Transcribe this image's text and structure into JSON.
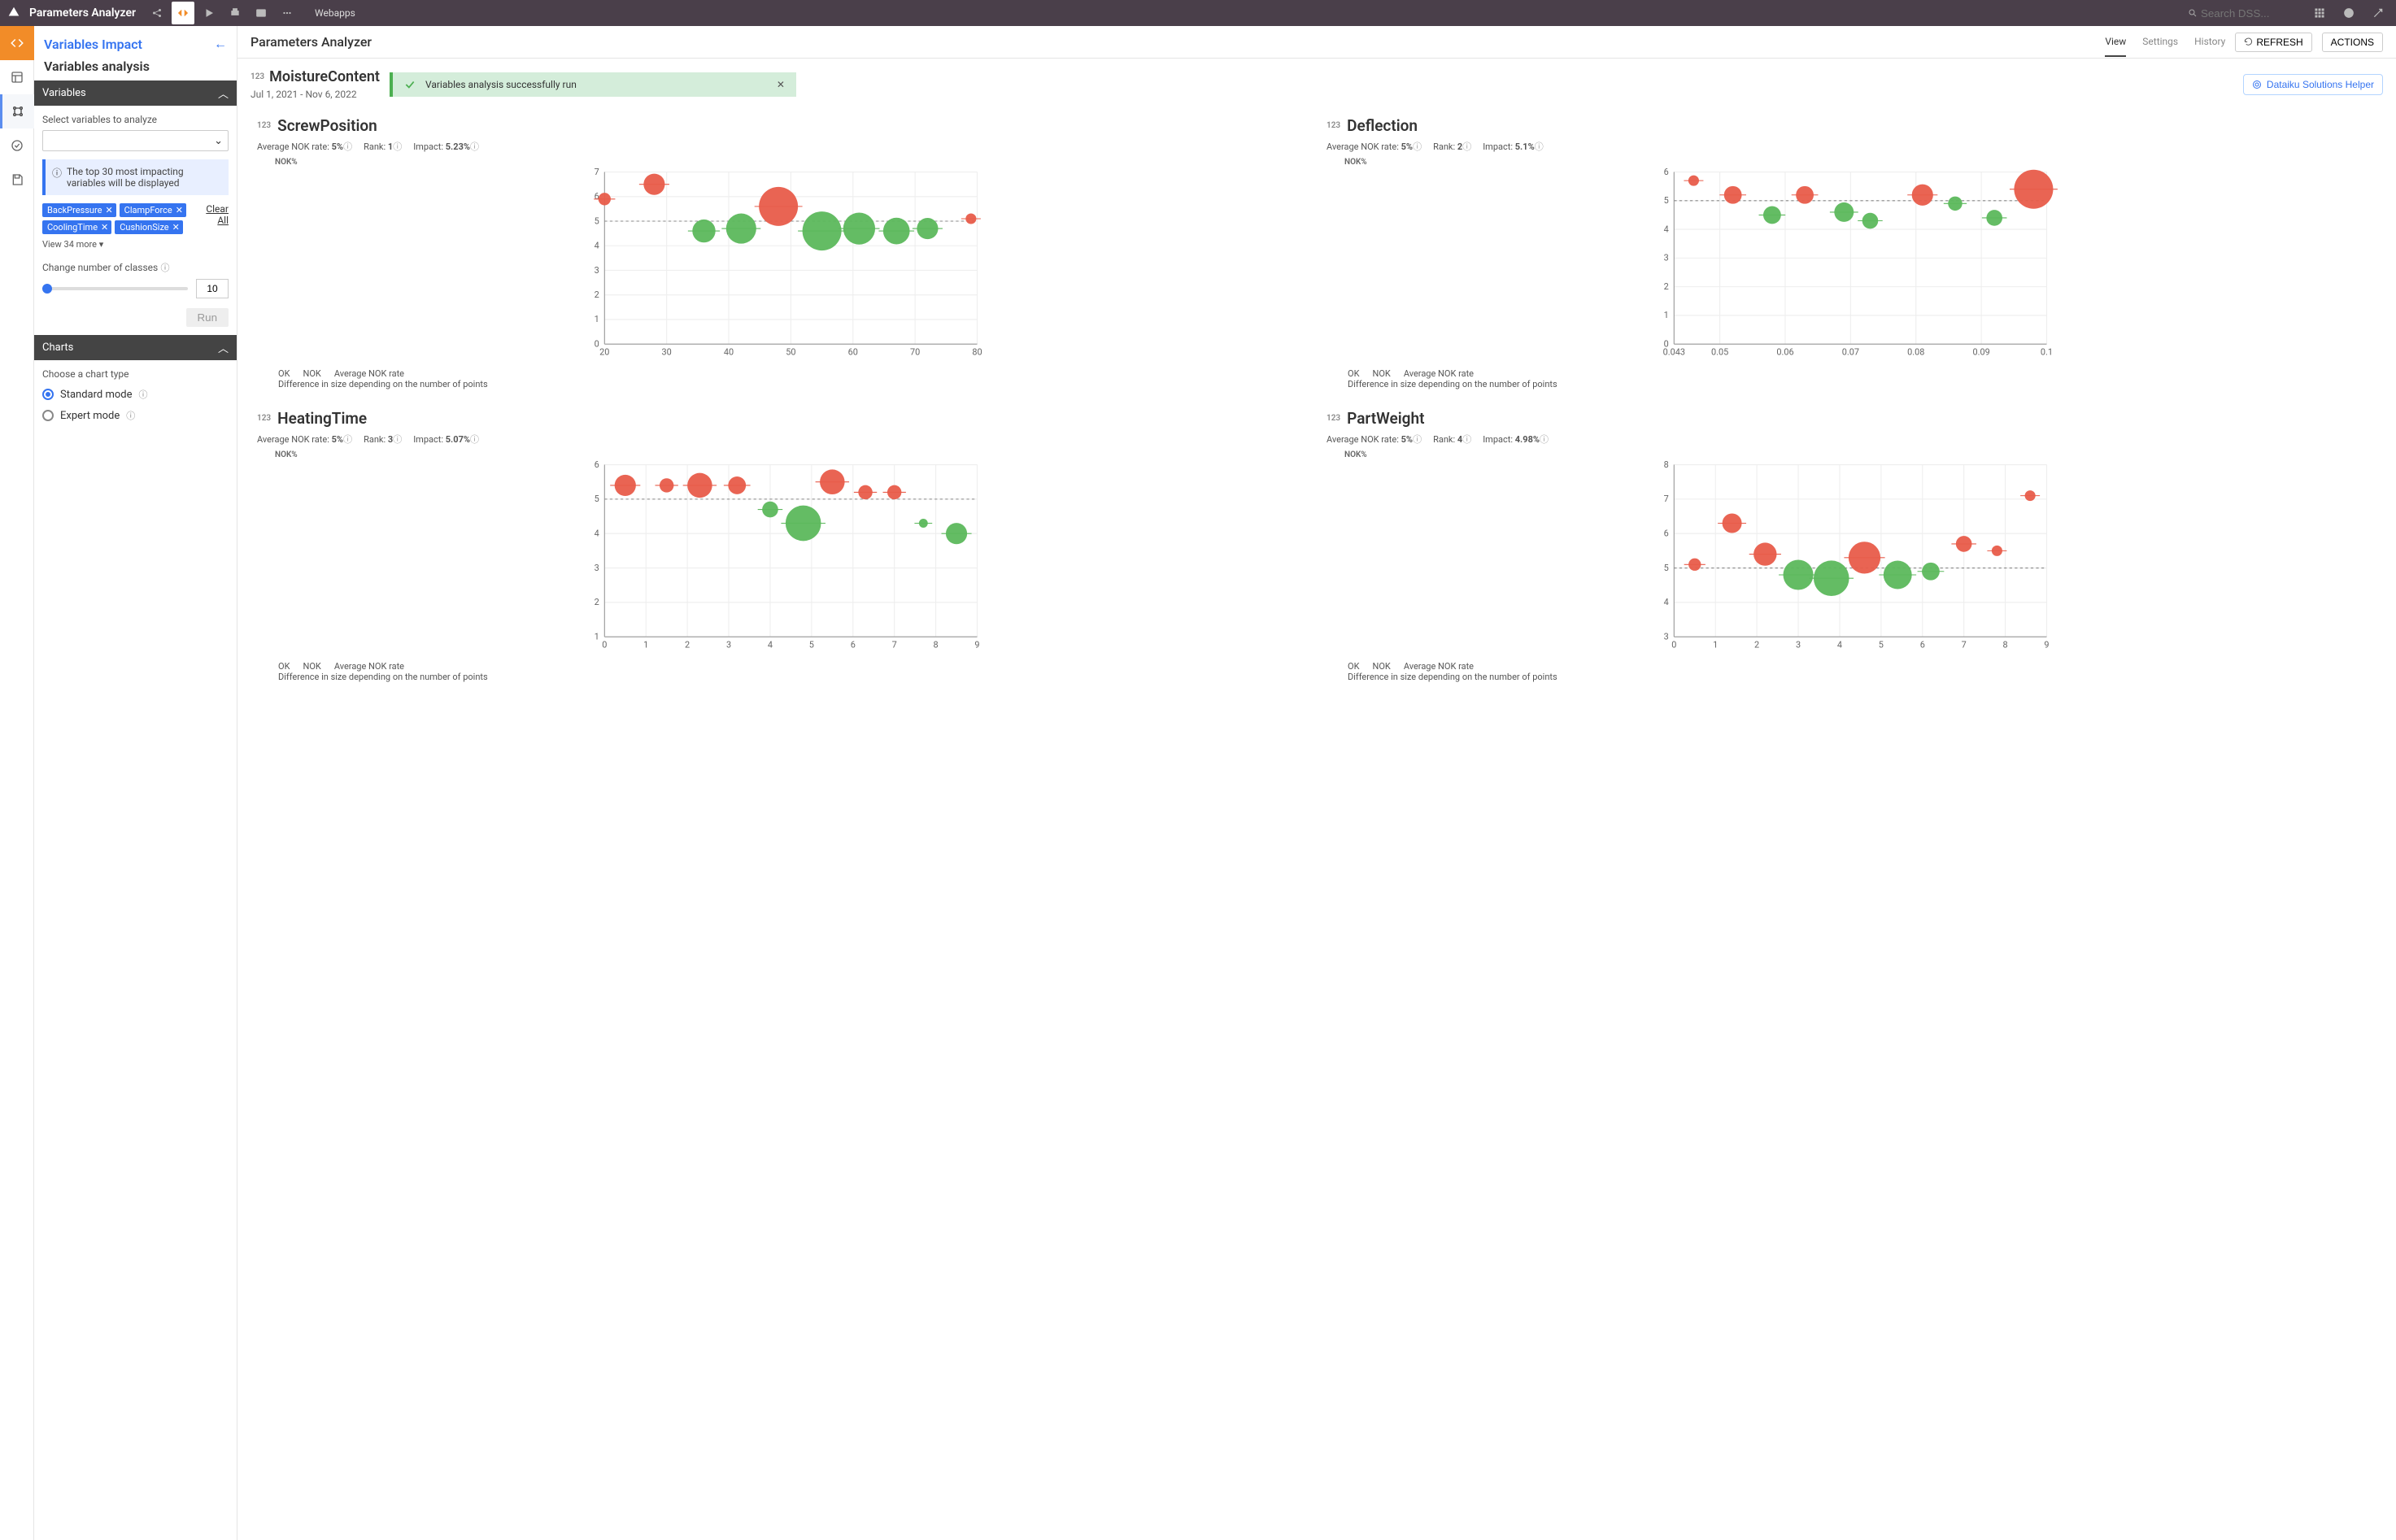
{
  "topbar": {
    "project_title": "Parameters Analyzer",
    "tag": "Webapps",
    "search_placeholder": "Search DSS..."
  },
  "leftnav": {
    "items": [
      "code",
      "dashboard",
      "analysis",
      "tasks",
      "save"
    ]
  },
  "sidebar": {
    "breadcrumb": "Variables Impact",
    "subtitle": "Variables analysis",
    "variables_section": {
      "title": "Variables",
      "select_label": "Select variables to analyze",
      "info_msg": "The top 30 most impacting variables will be displayed",
      "chips": [
        "BackPressure",
        "ClampForce",
        "CoolingTime",
        "CushionSize"
      ],
      "view_more": "View 34 more ▾",
      "clear": "Clear",
      "all": "All",
      "classes_label": "Change number of classes",
      "classes_value": "10",
      "run_label": "Run"
    },
    "charts_section": {
      "title": "Charts",
      "choose_label": "Choose a chart type",
      "options": [
        {
          "label": "Standard mode",
          "selected": true
        },
        {
          "label": "Expert mode",
          "selected": false
        }
      ]
    }
  },
  "header2": {
    "title": "Parameters Analyzer",
    "tabs": [
      "View",
      "Settings",
      "History"
    ],
    "active_tab": "View",
    "refresh": "REFRESH",
    "actions": "ACTIONS"
  },
  "kpi": {
    "type": "123",
    "name": "MoistureContent",
    "date_range": "Jul 1, 2021 - Nov 6, 2022"
  },
  "toast": {
    "msg": "Variables analysis successfully run"
  },
  "helper_button": "Dataiku Solutions Helper",
  "legend": {
    "ok": "OK",
    "nok": "NOK",
    "avg": "Average NOK rate",
    "note": "Difference in size depending on the number of points"
  },
  "chart_meta_labels": {
    "avg": "Average NOK rate:",
    "rank": "Rank:",
    "impact": "Impact:"
  },
  "axis_label": "NOK%",
  "chart_data": [
    {
      "name": "ScrewPosition",
      "type_pill": "123",
      "avg_nok": "5%",
      "rank": "1",
      "impact": "5.23%",
      "type": "scatter-bubble",
      "xticks": [
        20,
        30,
        40,
        50,
        60,
        70,
        80
      ],
      "yticks": [
        0,
        1,
        2,
        3,
        4,
        5,
        6,
        7
      ],
      "avg_line": 5,
      "points": [
        {
          "x": 20,
          "y": 5.9,
          "r": 7,
          "cls": "nok"
        },
        {
          "x": 28,
          "y": 6.5,
          "r": 12,
          "cls": "nok"
        },
        {
          "x": 36,
          "y": 4.6,
          "r": 13,
          "cls": "ok"
        },
        {
          "x": 42,
          "y": 4.7,
          "r": 17,
          "cls": "ok"
        },
        {
          "x": 48,
          "y": 5.6,
          "r": 22,
          "cls": "nok"
        },
        {
          "x": 55,
          "y": 4.6,
          "r": 22,
          "cls": "ok"
        },
        {
          "x": 61,
          "y": 4.7,
          "r": 18,
          "cls": "ok"
        },
        {
          "x": 67,
          "y": 4.6,
          "r": 15,
          "cls": "ok"
        },
        {
          "x": 72,
          "y": 4.7,
          "r": 12,
          "cls": "ok"
        },
        {
          "x": 79,
          "y": 5.1,
          "r": 6,
          "cls": "nok"
        }
      ]
    },
    {
      "name": "Deflection",
      "type_pill": "123",
      "avg_nok": "5%",
      "rank": "2",
      "impact": "5.1%",
      "type": "scatter-bubble",
      "xticks": [
        0.043,
        0.05,
        0.06,
        0.07,
        0.08,
        0.09,
        0.1
      ],
      "yticks": [
        0,
        1,
        2,
        3,
        4,
        5,
        6
      ],
      "avg_line": 5,
      "points": [
        {
          "x": 0.046,
          "y": 5.7,
          "r": 6,
          "cls": "nok"
        },
        {
          "x": 0.052,
          "y": 5.2,
          "r": 10,
          "cls": "nok"
        },
        {
          "x": 0.058,
          "y": 4.5,
          "r": 10,
          "cls": "ok"
        },
        {
          "x": 0.063,
          "y": 5.2,
          "r": 10,
          "cls": "nok"
        },
        {
          "x": 0.069,
          "y": 4.6,
          "r": 11,
          "cls": "ok"
        },
        {
          "x": 0.073,
          "y": 4.3,
          "r": 9,
          "cls": "ok"
        },
        {
          "x": 0.081,
          "y": 5.2,
          "r": 12,
          "cls": "nok"
        },
        {
          "x": 0.086,
          "y": 4.9,
          "r": 8,
          "cls": "ok"
        },
        {
          "x": 0.092,
          "y": 4.4,
          "r": 9,
          "cls": "ok"
        },
        {
          "x": 0.098,
          "y": 5.4,
          "r": 22,
          "cls": "nok"
        }
      ]
    },
    {
      "name": "HeatingTime",
      "type_pill": "123",
      "avg_nok": "5%",
      "rank": "3",
      "impact": "5.07%",
      "type": "scatter-bubble",
      "xticks": [
        0,
        1,
        2,
        3,
        4,
        5,
        6,
        7,
        8,
        9
      ],
      "yticks": [
        1,
        2,
        3,
        4,
        5,
        6
      ],
      "avg_line": 5,
      "points": [
        {
          "x": 0.5,
          "y": 5.4,
          "r": 12,
          "cls": "nok"
        },
        {
          "x": 1.5,
          "y": 5.4,
          "r": 8,
          "cls": "nok"
        },
        {
          "x": 2.3,
          "y": 5.4,
          "r": 14,
          "cls": "nok"
        },
        {
          "x": 3.2,
          "y": 5.4,
          "r": 10,
          "cls": "nok"
        },
        {
          "x": 4.0,
          "y": 4.7,
          "r": 9,
          "cls": "ok"
        },
        {
          "x": 4.8,
          "y": 4.3,
          "r": 20,
          "cls": "ok"
        },
        {
          "x": 5.5,
          "y": 5.5,
          "r": 14,
          "cls": "nok"
        },
        {
          "x": 6.3,
          "y": 5.2,
          "r": 8,
          "cls": "nok"
        },
        {
          "x": 7.0,
          "y": 5.2,
          "r": 8,
          "cls": "nok"
        },
        {
          "x": 7.7,
          "y": 4.3,
          "r": 5,
          "cls": "ok"
        },
        {
          "x": 8.5,
          "y": 4.0,
          "r": 12,
          "cls": "ok"
        }
      ]
    },
    {
      "name": "PartWeight",
      "type_pill": "123",
      "avg_nok": "5%",
      "rank": "4",
      "impact": "4.98%",
      "type": "scatter-bubble",
      "xticks": [
        0,
        1,
        2,
        3,
        4,
        5,
        6,
        7,
        8,
        9
      ],
      "yticks": [
        3,
        4,
        5,
        6,
        7,
        8
      ],
      "avg_line": 5,
      "points": [
        {
          "x": 0.5,
          "y": 5.1,
          "r": 7,
          "cls": "nok"
        },
        {
          "x": 1.4,
          "y": 6.3,
          "r": 11,
          "cls": "nok"
        },
        {
          "x": 2.2,
          "y": 5.4,
          "r": 13,
          "cls": "nok"
        },
        {
          "x": 3.0,
          "y": 4.8,
          "r": 17,
          "cls": "ok"
        },
        {
          "x": 3.8,
          "y": 4.7,
          "r": 20,
          "cls": "ok"
        },
        {
          "x": 4.6,
          "y": 5.3,
          "r": 18,
          "cls": "nok"
        },
        {
          "x": 5.4,
          "y": 4.8,
          "r": 16,
          "cls": "ok"
        },
        {
          "x": 6.2,
          "y": 4.9,
          "r": 10,
          "cls": "ok"
        },
        {
          "x": 7.0,
          "y": 5.7,
          "r": 9,
          "cls": "nok"
        },
        {
          "x": 7.8,
          "y": 5.5,
          "r": 6,
          "cls": "nok"
        },
        {
          "x": 8.6,
          "y": 7.1,
          "r": 6,
          "cls": "nok"
        }
      ]
    }
  ]
}
